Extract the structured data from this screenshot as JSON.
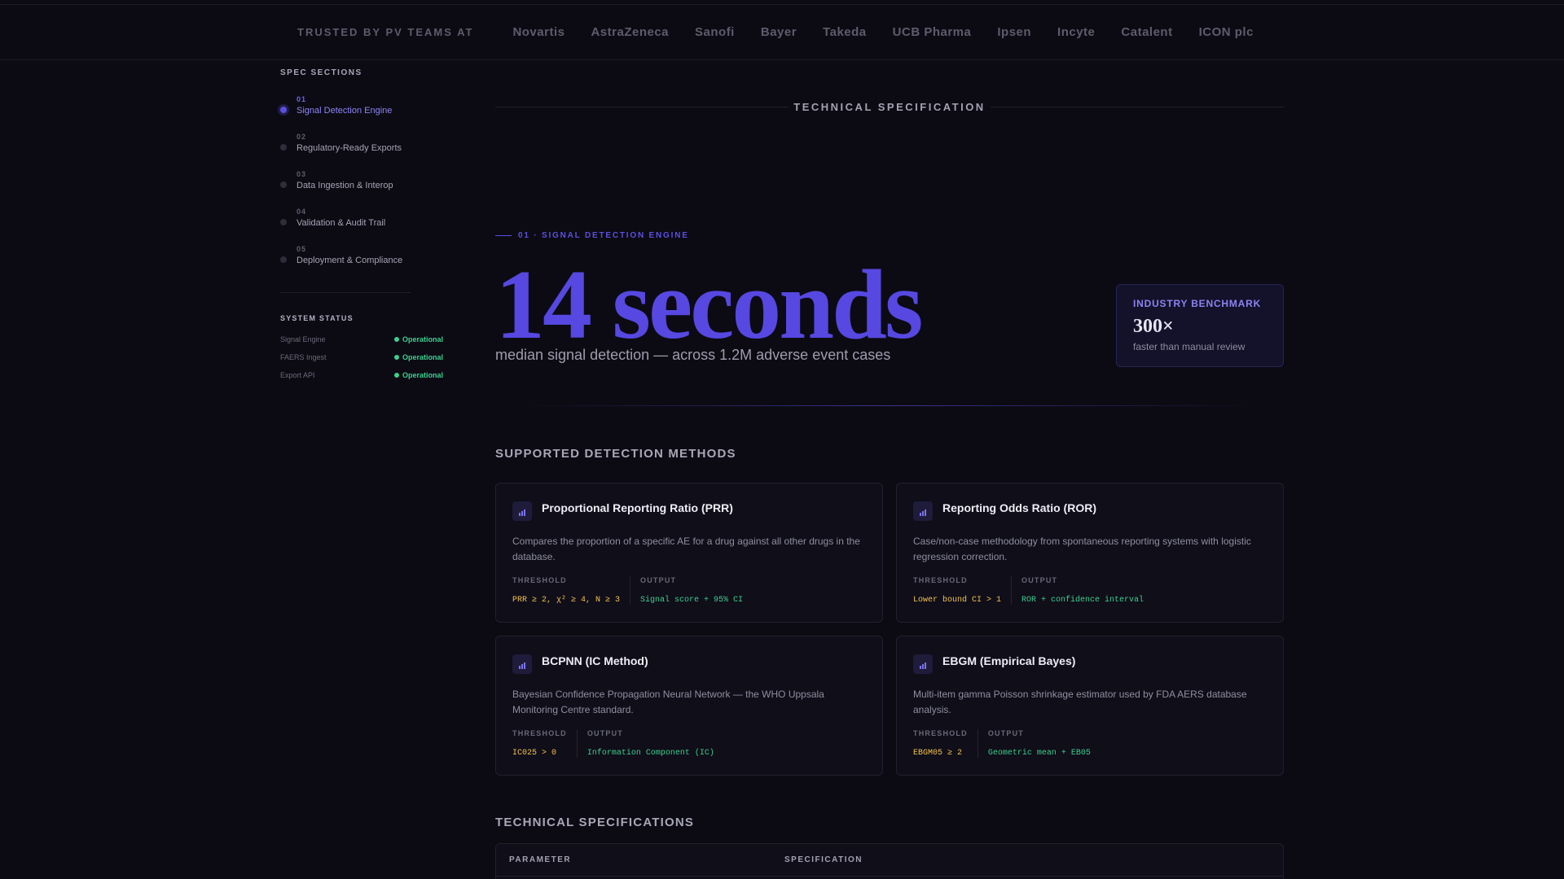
{
  "logos": {
    "trusted": "TRUSTED BY PV TEAMS AT",
    "companies": [
      "Novartis",
      "AstraZeneca",
      "Sanofi",
      "Bayer",
      "Takeda",
      "UCB Pharma",
      "Ipsen",
      "Incyte",
      "Catalent",
      "ICON plc"
    ]
  },
  "sidebar": {
    "title": "SPEC SECTIONS",
    "items": [
      {
        "num": "01",
        "label": "Signal Detection Engine"
      },
      {
        "num": "02",
        "label": "Regulatory-Ready Exports"
      },
      {
        "num": "03",
        "label": "Data Ingestion & Interop"
      },
      {
        "num": "04",
        "label": "Validation & Audit Trail"
      },
      {
        "num": "05",
        "label": "Deployment & Compliance"
      }
    ],
    "status_title": "SYSTEM STATUS",
    "status": [
      {
        "name": "Signal Engine",
        "value": "Operational"
      },
      {
        "name": "FAERS Ingest",
        "value": "Operational"
      },
      {
        "name": "Export API",
        "value": "Operational"
      }
    ]
  },
  "main": {
    "spec_heading": "TECHNICAL SPECIFICATION",
    "eyebrow": "01 · SIGNAL DETECTION ENGINE",
    "hero_number": "14 seconds",
    "hero_sub": "median signal detection — across 1.2M adverse event cases",
    "benchmark": {
      "title": "INDUSTRY BENCHMARK",
      "value": "300×",
      "sub": "faster than manual review"
    },
    "methods_title": "SUPPORTED DETECTION METHODS",
    "threshold_label": "THRESHOLD",
    "output_label": "OUTPUT",
    "methods": [
      {
        "title": "Proportional Reporting Ratio (PRR)",
        "desc": "Compares the proportion of a specific AE for a drug against all other drugs in the database.",
        "threshold": "PRR ≥ 2, χ² ≥ 4, N ≥ 3",
        "output": "Signal score + 95% CI"
      },
      {
        "title": "Reporting Odds Ratio (ROR)",
        "desc": "Case/non-case methodology from spontaneous reporting systems with logistic regression correction.",
        "threshold": "Lower bound CI > 1",
        "output": "ROR + confidence interval"
      },
      {
        "title": "BCPNN (IC Method)",
        "desc": "Bayesian Confidence Propagation Neural Network — the WHO Uppsala Monitoring Centre standard.",
        "threshold": "IC025 > 0",
        "output": "Information Component (IC)"
      },
      {
        "title": "EBGM (Empirical Bayes)",
        "desc": "Multi-item gamma Poisson shrinkage estimator used by FDA AERS database analysis.",
        "threshold": "EBGM05 ≥ 2",
        "output": "Geometric mean + EB05"
      }
    ],
    "specs_title": "TECHNICAL SPECIFICATIONS",
    "table_headers": [
      "PARAMETER",
      "SPECIFICATION"
    ]
  },
  "colors": {
    "accent": "#5648e0",
    "threshold": "#f2c14e",
    "output": "#3ecf8e",
    "background": "#0c0b14"
  }
}
